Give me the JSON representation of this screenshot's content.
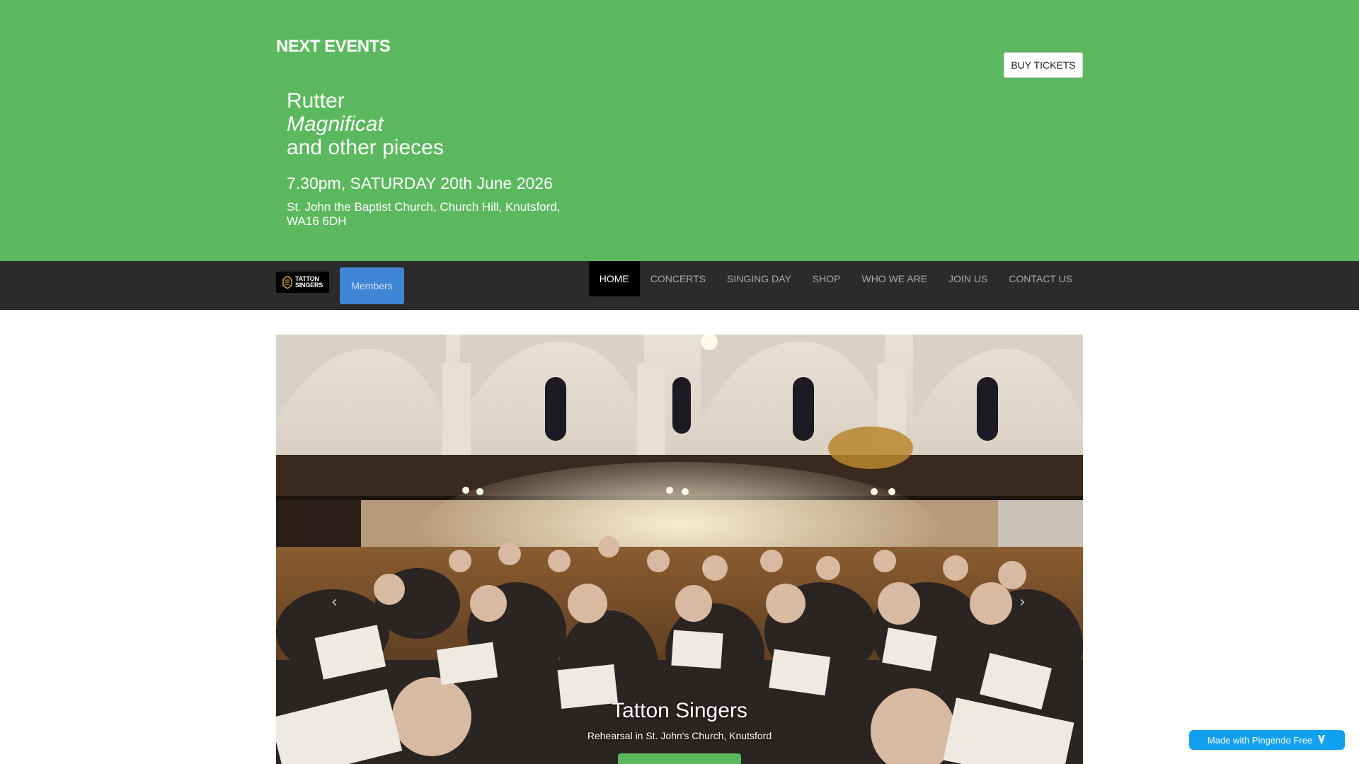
{
  "events": {
    "heading": "NEXT EVENTS",
    "buy_tickets": "BUY TICKETS",
    "title_line1": "Rutter",
    "title_line2": "Magnificat",
    "title_line3": "and other pieces",
    "time": "7.30pm, SATURDAY 20th June 2026",
    "venue": "St. John the Baptist Church, Church Hill, Knutsford, WA16 6DH"
  },
  "navbar": {
    "logo_text_line1": "TATTON",
    "logo_text_line2": "SINGERS",
    "members_label": "Members",
    "links": [
      {
        "label": "HOME",
        "active": true
      },
      {
        "label": "CONCERTS"
      },
      {
        "label": "SINGING DAY"
      },
      {
        "label": "SHOP"
      },
      {
        "label": "WHO WE ARE"
      },
      {
        "label": "JOIN US"
      },
      {
        "label": "CONTACT US"
      }
    ]
  },
  "carousel": {
    "prev_icon": "chevron-left-icon",
    "next_icon": "chevron-right-icon",
    "caption_title": "Tatton Singers",
    "caption_subtitle": "Rehearsal in St. John's Church, Knutsford"
  },
  "badge": {
    "label": "Made with Pingendo Free",
    "icon": "pingendo-icon"
  },
  "colors": {
    "events_bg": "#5cb85f",
    "navbar_bg": "#2b2b2b",
    "members_btn": "#3f85d6",
    "badge_bg": "#11a0f0"
  }
}
